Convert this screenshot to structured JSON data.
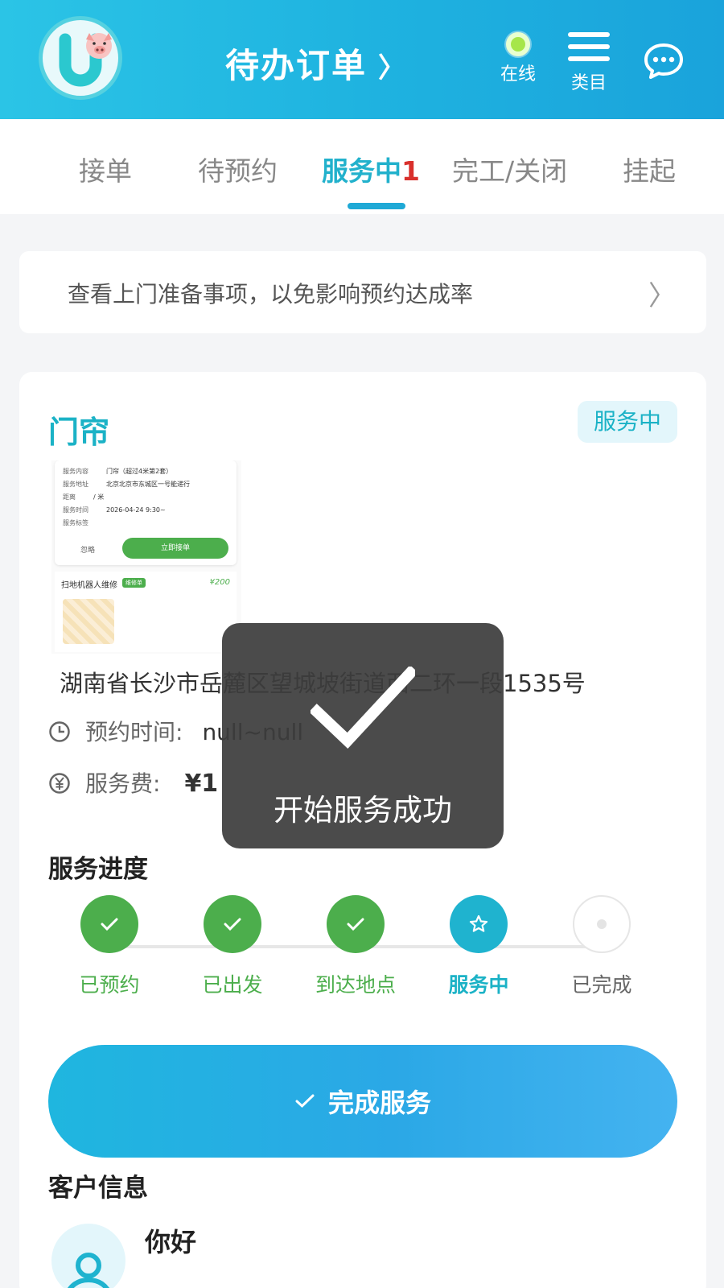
{
  "header": {
    "title": "待办订单",
    "online_label": "在线",
    "category_label": "类目",
    "colors": {
      "bar": "#1fb3e0",
      "online_dot": "#a6e64a"
    }
  },
  "tabs": [
    {
      "label": "接单"
    },
    {
      "label": "待预约"
    },
    {
      "label": "服务中",
      "badge": "1",
      "active": true
    },
    {
      "label": "完工/关闭"
    },
    {
      "label": "挂起"
    }
  ],
  "notice": {
    "text": "查看上门准备事项，以免影响预约达成率"
  },
  "order": {
    "service_name": "门帘",
    "status": "服务中",
    "thumbnail": {
      "rows": [
        {
          "label": "服务内容",
          "value": "门帘（超过4米第2套）"
        },
        {
          "label": "服务地址",
          "value": "北京北京市东城区一号能递行"
        },
        {
          "label": "距离",
          "value": "/ 米"
        },
        {
          "label": "服务时间",
          "value": "2026-04-24 9:30~"
        },
        {
          "label": "服务标签",
          "value": ""
        }
      ],
      "skip_label": "忽略",
      "accept_label": "立即接单",
      "item_title": "扫地机器人维修",
      "item_tag": "维修单",
      "item_price": "¥200"
    },
    "address": "湖南省长沙市岳麓区望城坡街道西二环一段1535号",
    "appointment_label": "预约时间:",
    "appointment_value": "null~null",
    "fee_label": "服务费:",
    "fee_value": "¥1"
  },
  "progress": {
    "title": "服务进度",
    "steps": [
      {
        "label": "已预约",
        "state": "done"
      },
      {
        "label": "已出发",
        "state": "done"
      },
      {
        "label": "到达地点",
        "state": "done"
      },
      {
        "label": "服务中",
        "state": "current"
      },
      {
        "label": "已完成",
        "state": "todo"
      }
    ]
  },
  "complete_button": {
    "label": "完成服务"
  },
  "customer": {
    "section_title": "客户信息",
    "name": "你好"
  },
  "toast": {
    "text": "开始服务成功",
    "icon": "checkmark-icon"
  }
}
